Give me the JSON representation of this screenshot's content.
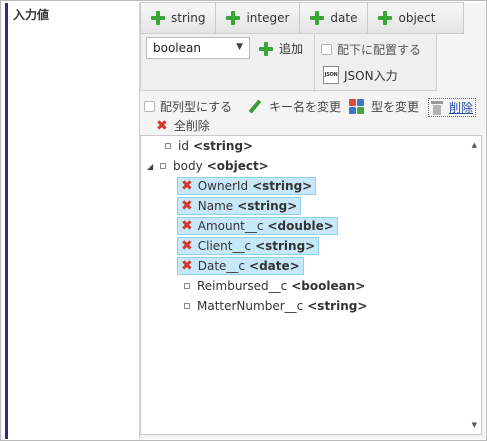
{
  "field_label": "入力値",
  "add_buttons": [
    {
      "label": "string"
    },
    {
      "label": "integer"
    },
    {
      "label": "date"
    },
    {
      "label": "object"
    }
  ],
  "type_select": {
    "value": "boolean",
    "arrow": "▼"
  },
  "add_label": "追加",
  "place_below_label": "配下に配置する",
  "json_icon_text": "JSON",
  "json_input_label": "JSON入力",
  "actions": {
    "array_label": "配列型にする",
    "rename_label": "キー名を変更",
    "change_type_label": "型を変更",
    "delete_label": "削除",
    "delete_all_label": "全削除"
  },
  "scroll": {
    "up": "▲",
    "down": "▼"
  },
  "tree": {
    "expander": "◢",
    "nodes": [
      {
        "name": "id",
        "type": "<string>"
      },
      {
        "name": "body",
        "type": "<object>"
      },
      {
        "name": "OwnerId",
        "type": "<string>"
      },
      {
        "name": "Name",
        "type": "<string>"
      },
      {
        "name": "Amount__c",
        "type": "<double>"
      },
      {
        "name": "Client__c",
        "type": "<string>"
      },
      {
        "name": "Date__c",
        "type": "<date>"
      },
      {
        "name": "Reimbursed__c",
        "type": "<boolean>"
      },
      {
        "name": "MatterNumber__c",
        "type": "<string>"
      }
    ],
    "selected_mark": "✖"
  },
  "colors": {
    "accent_green": "#3aa635",
    "selection_bg": "#c6e8f8",
    "delete_red": "#d8382c",
    "link_blue": "#2a4fa8"
  }
}
